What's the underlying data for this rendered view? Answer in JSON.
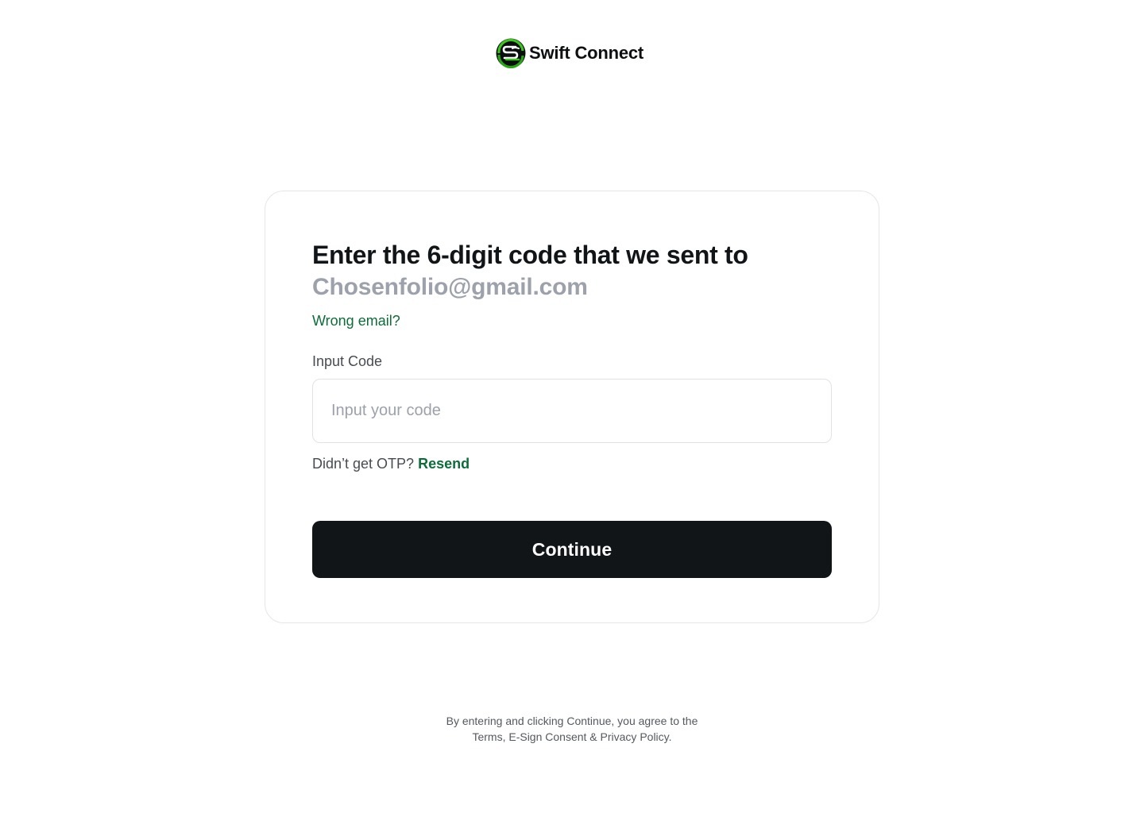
{
  "brand": {
    "name": "Swift Connect",
    "logo_icon": "swift-connect-logo-icon",
    "accent_color": "#0e6b3a",
    "logo_green": "#3ec41f"
  },
  "verify": {
    "heading": "Enter the 6-digit code that we sent to",
    "email": "Chosenfolio@gmail.com",
    "wrong_email_link": "Wrong email?",
    "input_label": "Input Code",
    "input_placeholder": "Input your code",
    "input_value": "",
    "resend_prompt": "Didn’t get OTP?",
    "resend_link": "Resend",
    "continue_label": "Continue"
  },
  "footer": {
    "legal_line1": "By entering and clicking Continue, you agree to the",
    "legal_line2": "Terms, E-Sign Consent & Privacy Policy."
  }
}
